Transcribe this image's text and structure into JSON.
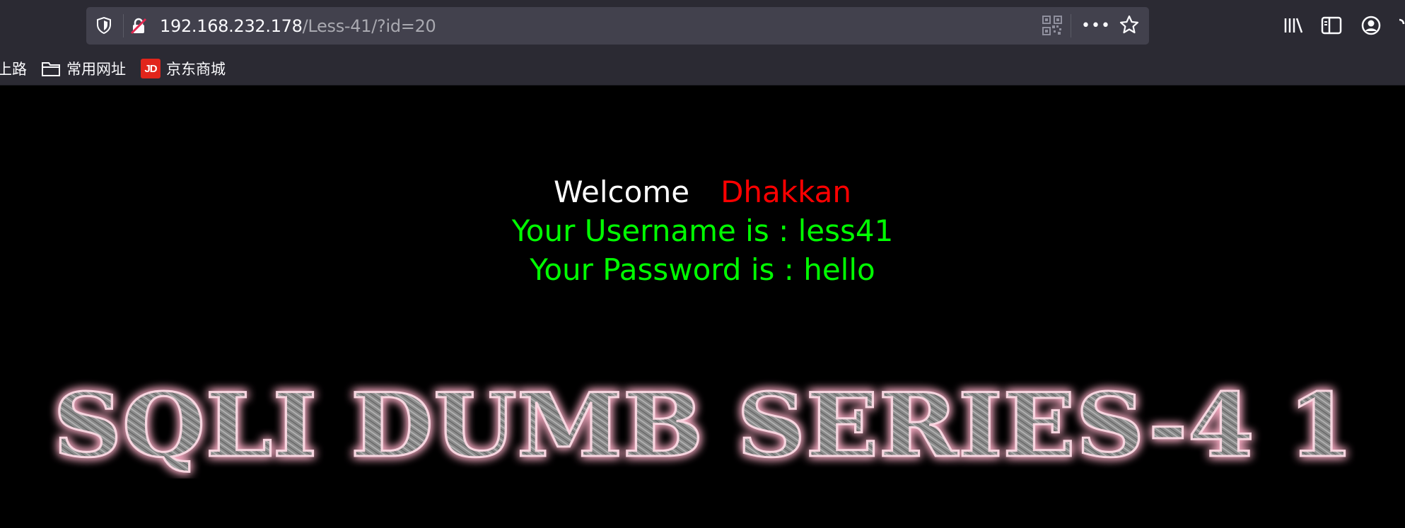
{
  "browser": {
    "url_host": "192.168.232.178",
    "url_path": "/Less-41/?id=20",
    "bookmarks": [
      {
        "label": "上路",
        "icon": "none"
      },
      {
        "label": "常用网址",
        "icon": "folder-icon"
      },
      {
        "label": "京东商城",
        "icon": "jd-icon"
      }
    ],
    "jd_icon_text": "JD"
  },
  "page": {
    "welcome_label": "Welcome",
    "user_name": "Dhakkan",
    "username_line": "Your Username is : less41",
    "password_line": "Your Password is : hello",
    "banner_title": "SQLI DUMB SERIES-4 1"
  },
  "colors": {
    "background": "#000000",
    "welcome": "#ffffff",
    "name": "#ff0000",
    "info": "#00ff00",
    "banner_glow": "#f4a9c0",
    "banner_fill": "#8c8c8c"
  }
}
